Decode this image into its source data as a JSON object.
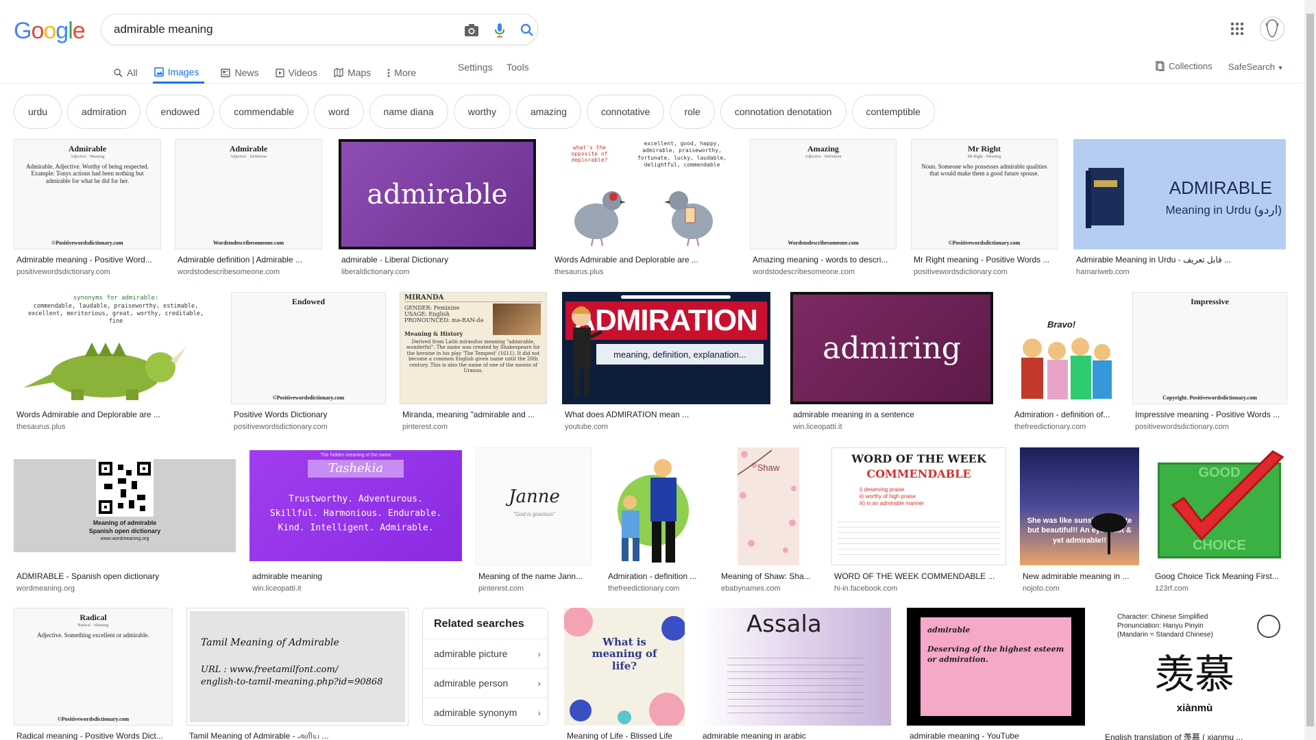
{
  "logo": "Google",
  "search": {
    "value": "admirable meaning"
  },
  "tabs": [
    {
      "label": "All",
      "icon": "search-icon"
    },
    {
      "label": "Images",
      "icon": "image-icon",
      "active": true
    },
    {
      "label": "News",
      "icon": "news-icon"
    },
    {
      "label": "Videos",
      "icon": "video-icon"
    },
    {
      "label": "Maps",
      "icon": "map-icon"
    },
    {
      "label": "More",
      "icon": "more-vert-icon"
    }
  ],
  "settings_label": "Settings",
  "tools_label": "Tools",
  "collections_label": "Collections",
  "safesearch_label": "SafeSearch",
  "chips": [
    "urdu",
    "admiration",
    "endowed",
    "commendable",
    "word",
    "name diana",
    "worthy",
    "amazing",
    "connotative",
    "role",
    "connotation denotation",
    "contemptible"
  ],
  "results": {
    "r1": {
      "cap": "Admirable meaning - Positive Word...",
      "src": "positivewordsdictionary.com",
      "title": "Admirable",
      "sub": "Adjective · Meaning",
      "body": "Admirable. Adjective. Worthy of being respected. Example: Tonys actions had been nothing but admirable for what he did for her.",
      "foot": "©Positivewordsdictionary.com"
    },
    "r2": {
      "cap": "Admirable definition | Admirable ...",
      "src": "wordstodescribesomeone.com",
      "title": "Admirable",
      "sub": "Adjective · Definition",
      "foot": "Wordstodescribesomeone.com"
    },
    "r3": {
      "cap": "admirable - Liberal Dictionary",
      "src": "liberaldictionary.com",
      "word": "admirable"
    },
    "r4": {
      "cap": "Words Admirable and Deplorable are ...",
      "src": "thesaurus.plus",
      "q": "what's the opposite of deplorable?",
      "words": "excellent, good, happy, admirable, praiseworthy, fortunate, lucky, laudable, delightful, commendable"
    },
    "r5": {
      "cap": "Amazing meaning - words to descri...",
      "src": "wordstodescribesomeone.com",
      "title": "Amazing",
      "sub": "Adjective · Definition",
      "foot": "Wordstodescribesomeone.com"
    },
    "r6": {
      "cap": "Mr Right meaning - Positive Words ...",
      "src": "positivewordsdictionary.com",
      "title": "Mr Right",
      "sub": "Mr Right · Meaning",
      "body": "Noun. Someone who possesses admirable qualities that would make them a good future spouse.",
      "foot": "©Positivewordsdictionary.com"
    },
    "r7": {
      "cap": "Admirable Meaning in Urdu - قابل تعریف ...",
      "src": "hamariweb.com",
      "big": "ADMIRABLE",
      "small": "Meaning in Urdu (اردو)"
    },
    "r8": {
      "cap": "Words Admirable and Deplorable are ...",
      "src": "thesaurus.plus",
      "syn": "synonyms for admirable:",
      "list": "commendable, laudable, praiseworthy, estimable, excellent, meritorious, great, worthy, creditable, fine"
    },
    "r9": {
      "cap": "Positive Words Dictionary",
      "src": "positivewordsdictionary.com",
      "title": "Endowed",
      "foot": "©Positivewordsdictionary.com"
    },
    "r10": {
      "cap": "Miranda, meaning \"admirable and ...",
      "src": "pinterest.com",
      "title": "MIRANDA",
      "gender": "GENDER: Feminine",
      "usage": "USAGE: English",
      "pron": "PRONOUNCED: mə-RAN-də",
      "mh": "Meaning & History",
      "body": "Derived from Latin mirandus meaning \"admirable, wonderful\". The name was created by Shakespeare for the heroine in his play 'The Tempest' (1611). It did not become a common English given name until the 20th century. This is also the name of one of the moons of Uranus."
    },
    "r11": {
      "cap": "What does ADMIRATION mean ...",
      "src": "youtube.com",
      "big": "ADMIRATION",
      "small": "meaning, definition, explanation..."
    },
    "r12": {
      "cap": "admirable meaning in a sentence",
      "src": "win.liceopatti.it",
      "word": "admiring"
    },
    "r13": {
      "cap": "Admiration - definition of...",
      "src": "thefreedictionary.com",
      "bravo": "Bravo!"
    },
    "r14": {
      "cap": "Impressive meaning - Positive Words ...",
      "src": "positivewordsdictionary.com",
      "title": "Impressive",
      "foot": "Copyright. Positivewordsdictionary.com"
    },
    "r15": {
      "cap": "ADMIRABLE - Spanish open dictionary",
      "src": "wordmeaning.org",
      "l1": "Meaning of admirable",
      "l2": "Spanish open dictionary",
      "l3": "www.wordmeaning.org"
    },
    "r16": {
      "cap": "admirable meaning",
      "src": "win.liceopatti.it",
      "top": "The hidden meaning of the name",
      "name": "Tashekia",
      "body": "Trustworthy. Adventurous. Skillful. Harmonious. Endurable. Kind. Intelligent. Admirable."
    },
    "r17": {
      "cap": "Meaning of the name Jann...",
      "src": "pinterest.com",
      "name": "Janne",
      "sub": "\"God is gracious\""
    },
    "r18": {
      "cap": "Admiration - definition ...",
      "src": "thefreedictionary.com"
    },
    "r19": {
      "cap": "Meaning of Shaw: Sha...",
      "src": "ebabynames.com",
      "name": "Shaw"
    },
    "r20": {
      "cap": "WORD OF THE WEEK COMMENDABLE ...",
      "src": "hi-in.facebook.com",
      "h": "WORD OF THE WEEK",
      "w": "COMMENDABLE",
      "m1": "i) deserving praise",
      "m2": "ii) worthy of high praise",
      "m3": "iii) in an admirable manner"
    },
    "r21": {
      "cap": "New admirable meaning in ...",
      "src": "nojoto.com",
      "quote": "She was like sunshine - quite but beautiful!! An eye feast & yet admirable!!"
    },
    "r22": {
      "cap": "Goog Choice Tick Meaning First...",
      "src": "123rf.com",
      "g1": "GOOD",
      "g2": "CHOICE"
    },
    "r23": {
      "cap": "Radical meaning - Positive Words Dict...",
      "title": "Radical",
      "sub": "Radical · Meaning",
      "body": "Adjective. Something excellent or admirable.",
      "foot": "©Positivewordsdictionary.com"
    },
    "r24": {
      "cap": "Tamil Meaning of Admirable - அரிய ...",
      "l1": "Tamil Meaning of Admirable",
      "l2": "URL : www.freetamilfont.com/",
      "l3": "english-to-tamil-meaning.php?id=90868"
    },
    "r25": {
      "cap": "Meaning of Life - Blissed Life",
      "q": "What is meaning of life?"
    },
    "r26": {
      "cap": "admirable meaning in arabic",
      "name": "Assala"
    },
    "r27": {
      "cap": "admirable meaning - YouTube",
      "w": "admirable",
      "d": "Deserving of the highest esteem or admiration."
    },
    "r28": {
      "cap": "English translation of 羡慕 ( xianmu ...",
      "l1": "Character: Chinese Simplified",
      "l2": "Pronunciation: Hanyu Pinyin",
      "l3": "(Mandarin = Standard Chinese)",
      "han": "羡慕",
      "pinyin": "xiànmù"
    }
  },
  "related": {
    "title": "Related searches",
    "items": [
      "admirable picture",
      "admirable person",
      "admirable synonym"
    ]
  },
  "colors": {
    "blue": "#4285f4",
    "red": "#ea4335",
    "yellow": "#fbbc05",
    "green": "#34a853",
    "accent": "#1a73e8"
  }
}
